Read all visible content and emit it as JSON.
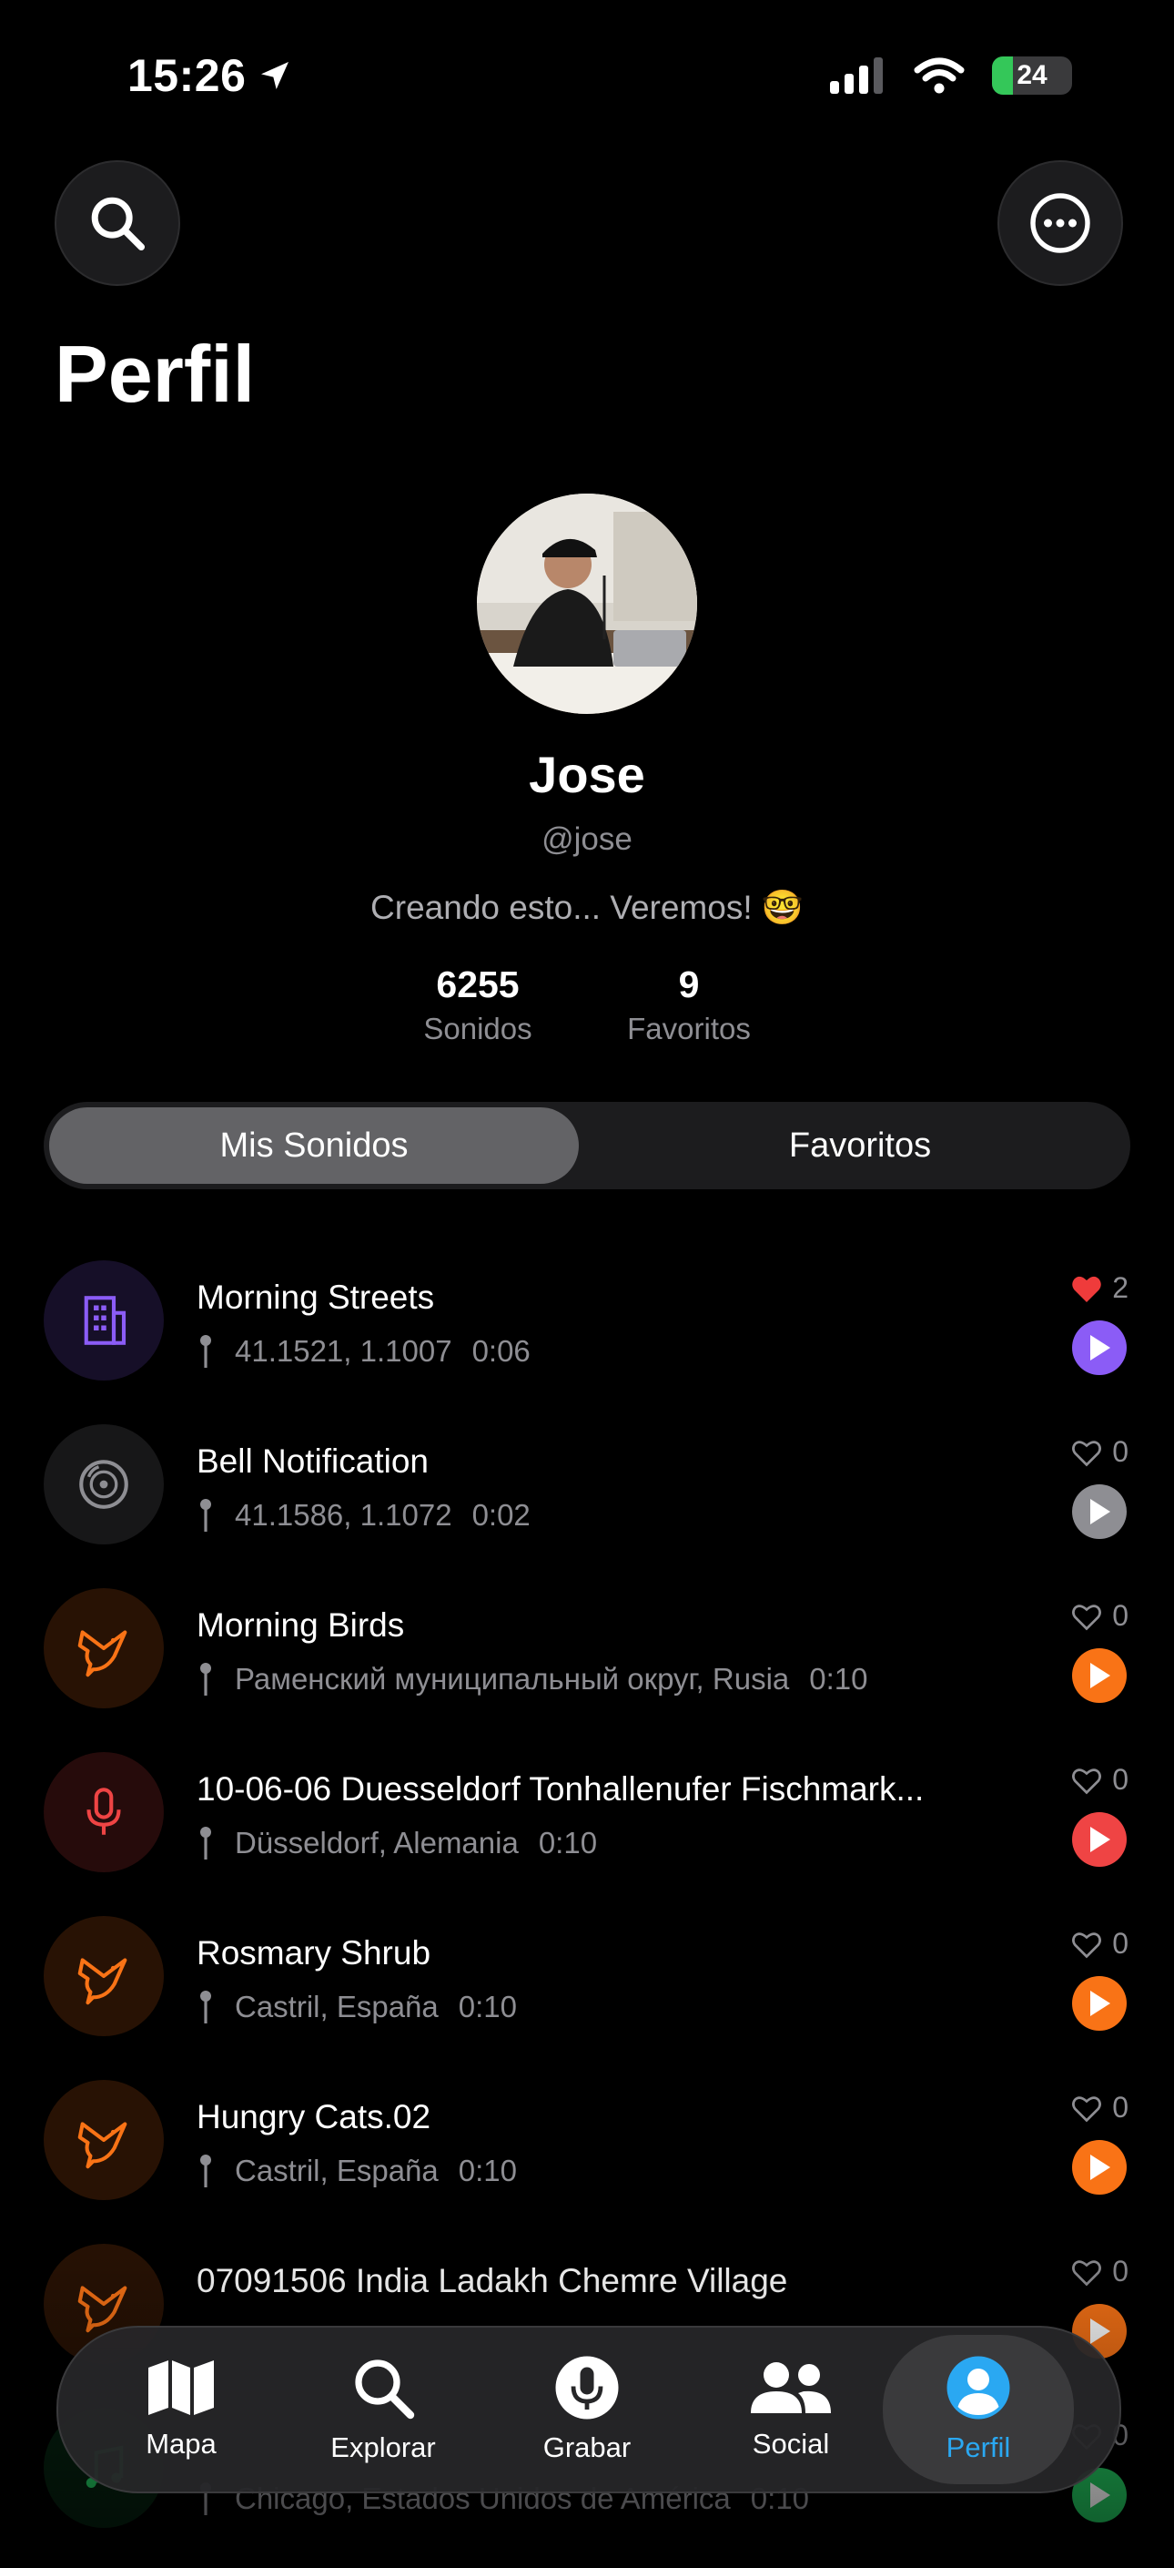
{
  "status_bar": {
    "time": "15:26",
    "battery": "24"
  },
  "header": {
    "title": "Perfil"
  },
  "profile": {
    "name": "Jose",
    "handle": "@jose",
    "bio": "Creando esto... Veremos! 🤓",
    "stats": [
      {
        "value": "6255",
        "label": "Sonidos"
      },
      {
        "value": "9",
        "label": "Favoritos"
      }
    ]
  },
  "segment": {
    "options": [
      "Mis Sonidos",
      "Favoritos"
    ],
    "selected": "Mis Sonidos"
  },
  "sounds": [
    {
      "title": "Morning Streets",
      "location": "41.1521, 1.1007",
      "duration": "0:06",
      "likes": "2",
      "liked": true,
      "category": "city-icon",
      "color": "#8b5cf6"
    },
    {
      "title": "Bell Notification",
      "location": "41.1586, 1.1072",
      "duration": "0:02",
      "likes": "0",
      "liked": false,
      "category": "disc-icon",
      "color": "#8e8e93"
    },
    {
      "title": "Morning Birds",
      "location": "Раменский муниципальный округ, Rusia",
      "duration": "0:10",
      "likes": "0",
      "liked": false,
      "category": "bird-icon",
      "color": "#f97316"
    },
    {
      "title": "10-06-06 Duesseldorf Tonhallenufer Fischmark...",
      "location": "Düsseldorf, Alemania",
      "duration": "0:10",
      "likes": "0",
      "liked": false,
      "category": "microphone-icon",
      "color": "#ef4444"
    },
    {
      "title": "Rosmary Shrub",
      "location": "Castril, España",
      "duration": "0:10",
      "likes": "0",
      "liked": false,
      "category": "bird-icon",
      "color": "#f97316"
    },
    {
      "title": "Hungry Cats.02",
      "location": "Castril, España",
      "duration": "0:10",
      "likes": "0",
      "liked": false,
      "category": "bird-icon",
      "color": "#f97316"
    },
    {
      "title": "07091506 India Ladakh Chemre Village",
      "location": "",
      "duration": "",
      "likes": "0",
      "liked": false,
      "category": "bird-icon",
      "color": "#f97316"
    },
    {
      "title": "",
      "location": "Chicago, Estados Unidos de América",
      "duration": "0:10",
      "likes": "0",
      "liked": false,
      "category": "music-icon",
      "color": "#22c55e"
    }
  ],
  "tabbar": [
    {
      "label": "Mapa",
      "icon": "map-icon"
    },
    {
      "label": "Explorar",
      "icon": "search-icon"
    },
    {
      "label": "Grabar",
      "icon": "microphone-icon"
    },
    {
      "label": "Social",
      "icon": "people-icon"
    },
    {
      "label": "Perfil",
      "icon": "person-icon",
      "active": true
    }
  ]
}
